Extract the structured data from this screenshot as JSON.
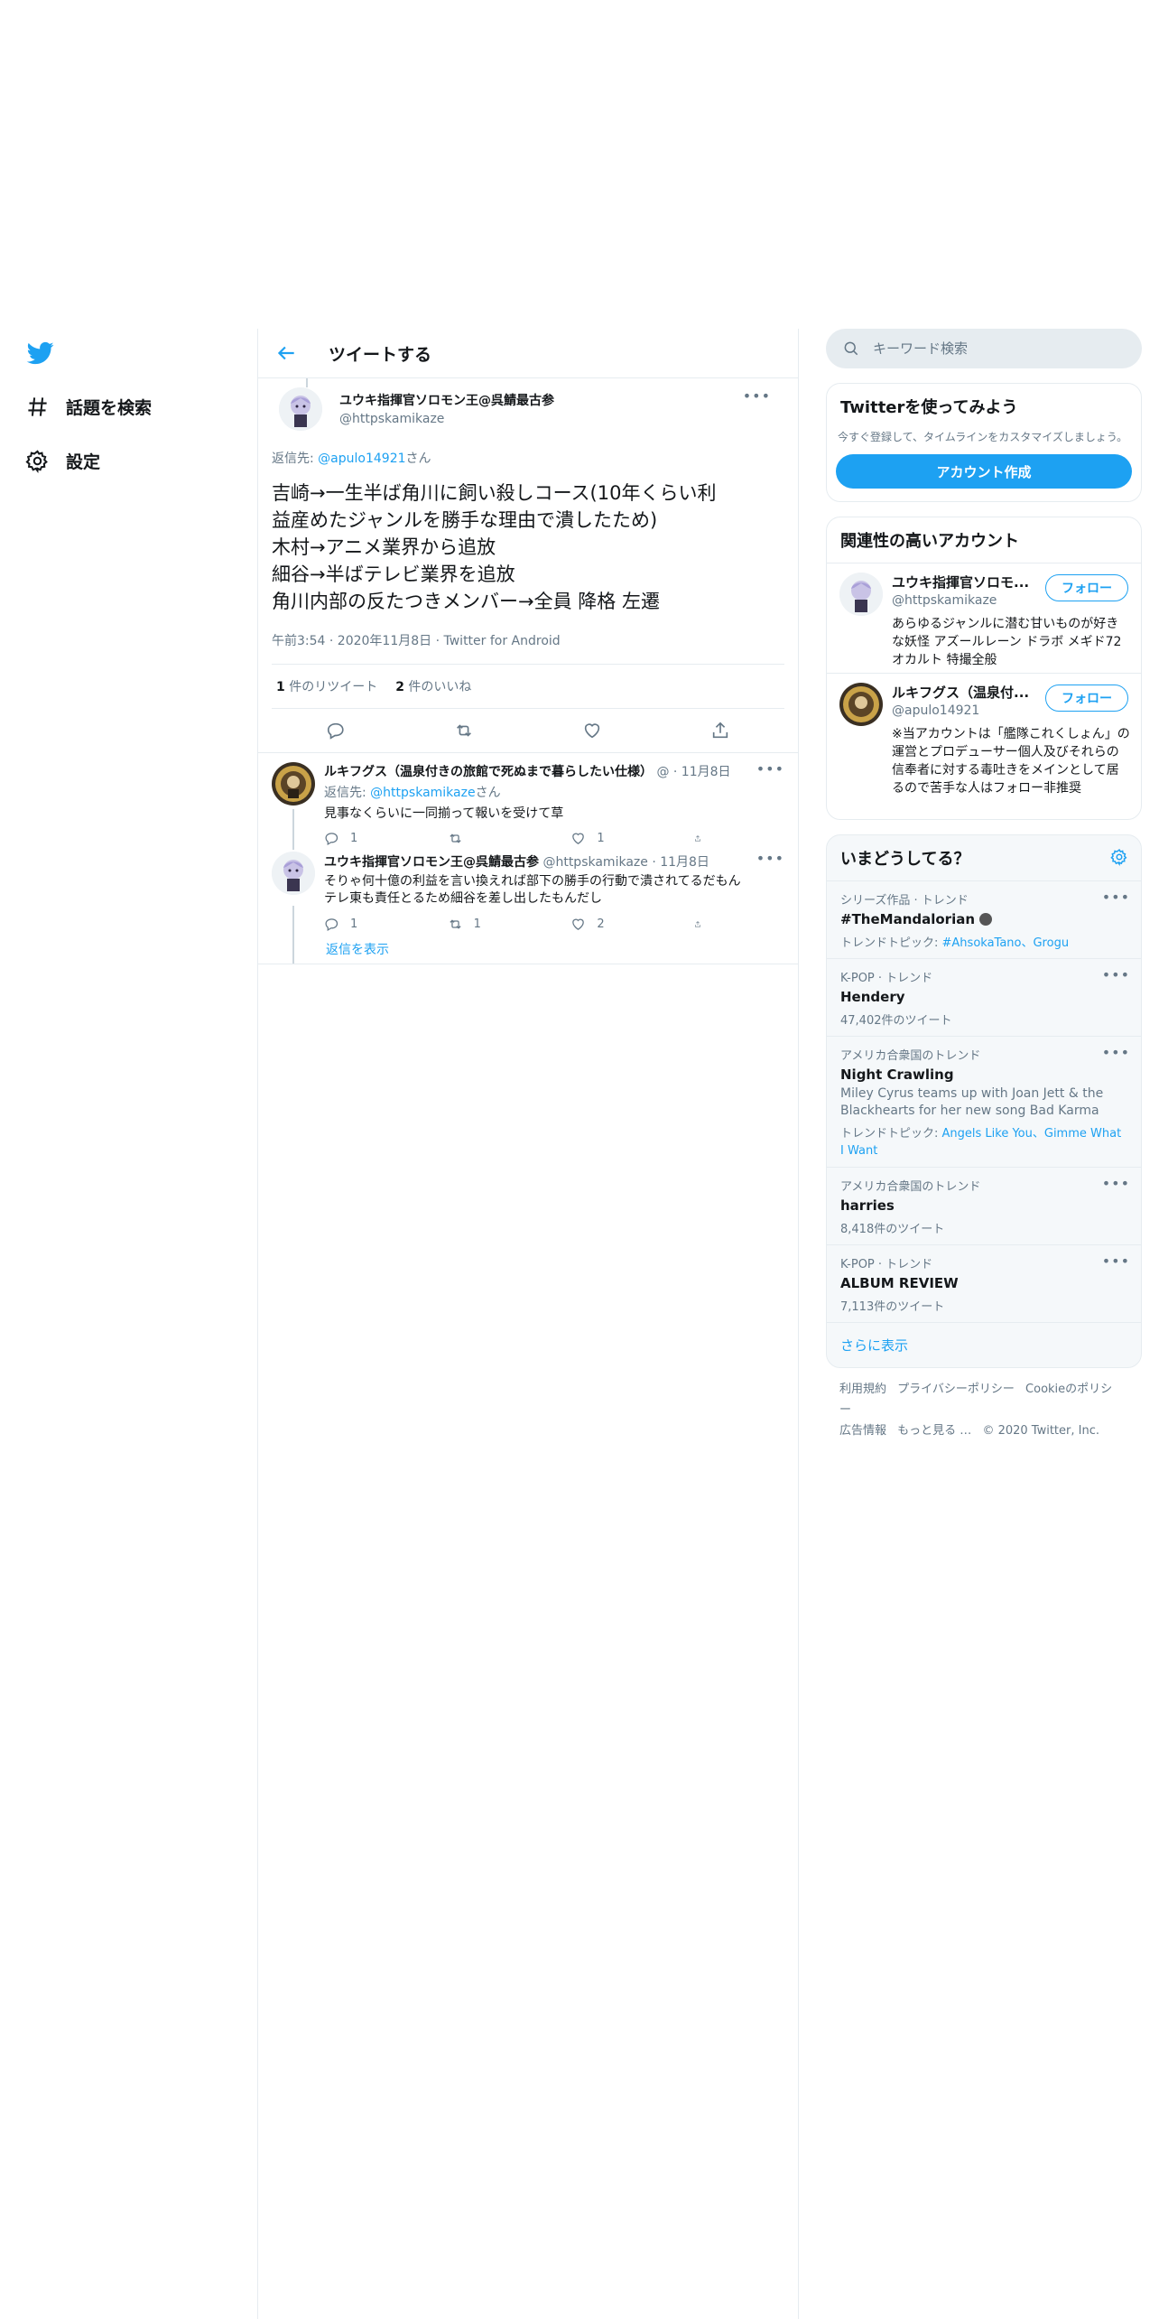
{
  "nav": {
    "explore_label": "話題を検索",
    "settings_label": "設定"
  },
  "header": {
    "title": "ツイートする"
  },
  "focal_tweet": {
    "author_name": "ユウキ指揮官ソロモン王@呉鯖最古参",
    "author_handle": "@httpskamikaze",
    "reply_prefix": "返信先: ",
    "reply_to": "@apulo14921",
    "reply_suffix": "さん",
    "text_lines": [
      "吉崎→一生半ば角川に飼い殺しコース(10年くらい利",
      "益産めたジャンルを勝手な理由で潰したため)",
      "木村→アニメ業界から追放",
      "細谷→半ばテレビ業界を追放",
      "角川内部の反たつきメンバー→全員 降格 左遷"
    ],
    "timestamp": "午前3:54 · 2020年11月8日 · Twitter for Android",
    "retweet_count": "1",
    "retweet_label": " 件のリツイート",
    "like_count": "2",
    "like_label": " 件のいいね"
  },
  "replies": [
    {
      "author_name": "ルキフグス（温泉付きの旅館で死ぬまで暮らしたい仕様）",
      "author_handle": "@",
      "date": "· 11月8日",
      "reply_prefix": "返信先: ",
      "reply_to": "@httpskamikaze",
      "reply_suffix": "さん",
      "text": "見事なくらいに一同揃って報いを受けて草",
      "reply_count": "1",
      "retweet_count": "",
      "like_count": "1"
    },
    {
      "author_name": "ユウキ指揮官ソロモン王@呉鯖最古参",
      "author_handle": "@httpskamikaze",
      "date": "· 11月8日",
      "text_lines": [
        "そりゃ何十億の利益を言い換えれば部下の勝手の行動で潰されてるだもん",
        "テレ東も責任とるため細谷を差し出したもんだし"
      ],
      "reply_count": "1",
      "retweet_count": "1",
      "like_count": "2"
    }
  ],
  "show_replies": "返信を表示",
  "search": {
    "placeholder": "キーワード検索"
  },
  "signup_card": {
    "title": "Twitterを使ってみよう",
    "text": "今すぐ登録して、タイムラインをカスタマイズしましょう。",
    "button": "アカウント作成"
  },
  "related": {
    "title": "関連性の高いアカウント",
    "follow_label": "フォロー",
    "accounts": [
      {
        "name": "ユウキ指揮官ソロモ...",
        "handle": "@httpskamikaze",
        "bio": "あらゆるジャンルに潜む甘いものが好きな妖怪 アズールレーン ドラボ メギド72 オカルト 特撮全般"
      },
      {
        "name": "ルキフグス（温泉付...",
        "handle": "@apulo14921",
        "bio": "※当アカウントは「艦隊これくしょん」の運営とプロデューサー個人及びそれらの信奉者に対する毒吐きをメインとして居るので苦手な人はフォロー非推奨"
      }
    ]
  },
  "trends": {
    "title": "いまどうしてる？",
    "items": [
      {
        "meta": "シリーズ作品 · トレンド",
        "name": "#TheMandalorian",
        "sub_prefix": "トレンドトピック: ",
        "sub_links": "#AhsokaTano、Grogu",
        "count": ""
      },
      {
        "meta": "K-POP · トレンド",
        "name": "Hendery",
        "count": "47,402件のツイート"
      },
      {
        "meta": "アメリカ合衆国のトレンド",
        "name": "Night Crawling",
        "desc": "Miley Cyrus teams up with Joan Jett & the Blackhearts for her new song Bad Karma",
        "sub_prefix": "トレンドトピック: ",
        "sub_links": "Angels Like You、Gimme What I Want"
      },
      {
        "meta": "アメリカ合衆国のトレンド",
        "name": "harries",
        "count": "8,418件のツイート"
      },
      {
        "meta": "K-POP · トレンド",
        "name": "ALBUM REVIEW",
        "count": "7,113件のツイート"
      }
    ],
    "show_more": "さらに表示"
  },
  "footer": {
    "links": [
      "利用規約",
      "プライバシーポリシー",
      "Cookieのポリシー",
      "広告情報",
      "もっと見る …"
    ],
    "copyright": "© 2020 Twitter, Inc."
  },
  "colors": {
    "accent": "#1da1f2",
    "text": "#14171a",
    "muted": "#657786",
    "border": "#e6ecf0"
  }
}
